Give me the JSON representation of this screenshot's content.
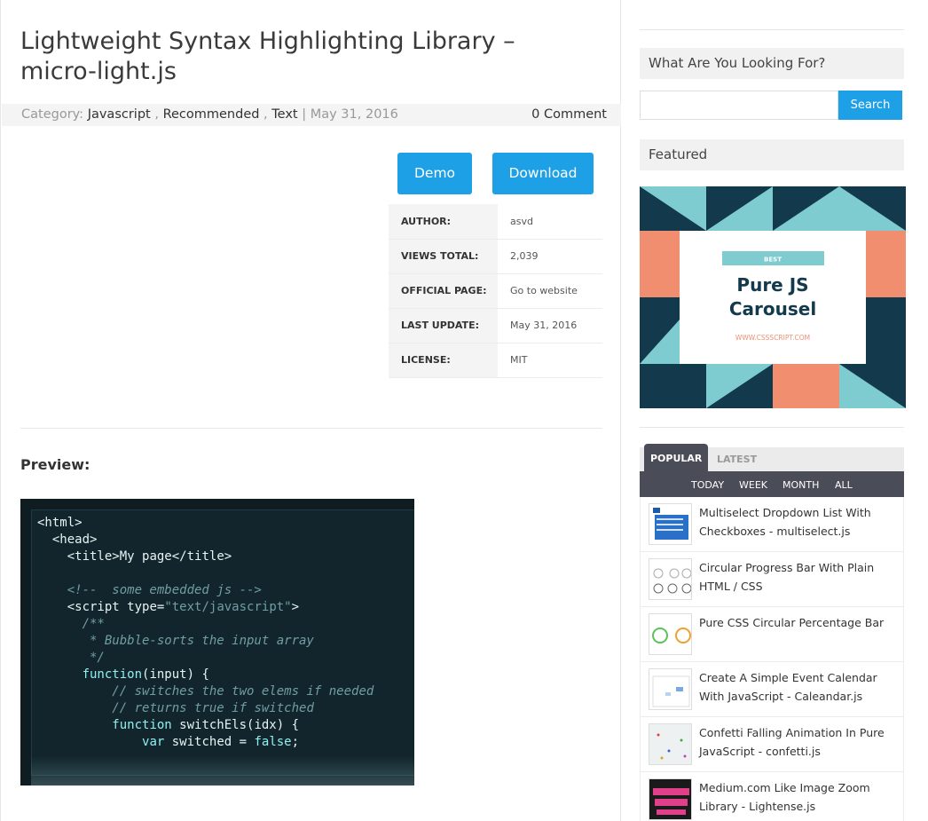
{
  "article": {
    "title": "Lightweight Syntax Highlighting Library – micro-light.js",
    "category_prefix": "Category: ",
    "categories": [
      "Javascript",
      "Recommended",
      "Text"
    ],
    "date": "May 31, 2016",
    "comments": "0 Comment",
    "demo_label": "Demo",
    "download_label": "Download",
    "info": [
      {
        "key": "AUTHOR:",
        "value": "asvd"
      },
      {
        "key": "VIEWS TOTAL:",
        "value": "2,039"
      },
      {
        "key": "OFFICIAL PAGE:",
        "value": "Go to website"
      },
      {
        "key": "LAST UPDATE:",
        "value": "May 31, 2016"
      },
      {
        "key": "LICENSE:",
        "value": "MIT"
      }
    ],
    "preview_heading": "Preview:"
  },
  "sidebar": {
    "search_heading": "What Are You Looking For?",
    "search_button": "Search",
    "featured_heading": "Featured",
    "featured_banner": {
      "tag": "BEST",
      "line1": "Pure JS",
      "line2": "Carousel",
      "site": "WWW.CSSSCRIPT.COM"
    },
    "tabs": [
      "POPULAR",
      "LATEST"
    ],
    "subtabs": [
      "TODAY",
      "WEEK",
      "MONTH",
      "ALL"
    ],
    "popular": [
      "Multiselect Dropdown List With Checkboxes - multiselect.js",
      "Circular Progress Bar With Plain HTML / CSS",
      "Pure CSS Circular Percentage Bar",
      "Create A Simple Event Calendar With JavaScript - Caleandar.js",
      "Confetti Falling Animation In Pure JavaScript - confetti.js",
      "Medium.com Like Image Zoom Library - Lightense.js"
    ]
  },
  "colors": {
    "accent": "#1ea0e6",
    "tab_dark": "#4a4d57",
    "code_bg": "#13252c",
    "banner_teal": "#7ecbd0",
    "banner_navy": "#123a4c",
    "banner_salmon": "#f28e70"
  }
}
